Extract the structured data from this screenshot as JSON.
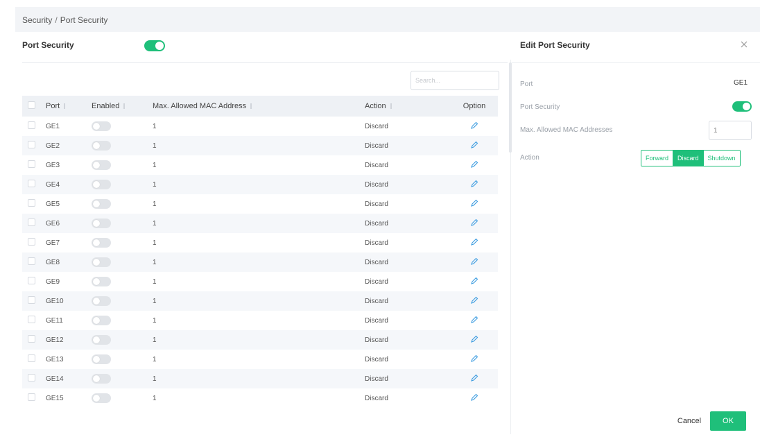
{
  "breadcrumb": {
    "parent": "Security",
    "separator": "/",
    "current": "Port Security"
  },
  "port_security": {
    "title": "Port Security",
    "enabled": true
  },
  "search": {
    "placeholder": "Search..."
  },
  "table": {
    "columns": {
      "port": "Port",
      "enabled": "Enabled",
      "max_mac": "Max. Allowed MAC Address",
      "action": "Action",
      "option": "Option"
    },
    "rows": [
      {
        "port": "GE1",
        "enabled": false,
        "max_mac": "1",
        "action": "Discard"
      },
      {
        "port": "GE2",
        "enabled": false,
        "max_mac": "1",
        "action": "Discard"
      },
      {
        "port": "GE3",
        "enabled": false,
        "max_mac": "1",
        "action": "Discard"
      },
      {
        "port": "GE4",
        "enabled": false,
        "max_mac": "1",
        "action": "Discard"
      },
      {
        "port": "GE5",
        "enabled": false,
        "max_mac": "1",
        "action": "Discard"
      },
      {
        "port": "GE6",
        "enabled": false,
        "max_mac": "1",
        "action": "Discard"
      },
      {
        "port": "GE7",
        "enabled": false,
        "max_mac": "1",
        "action": "Discard"
      },
      {
        "port": "GE8",
        "enabled": false,
        "max_mac": "1",
        "action": "Discard"
      },
      {
        "port": "GE9",
        "enabled": false,
        "max_mac": "1",
        "action": "Discard"
      },
      {
        "port": "GE10",
        "enabled": false,
        "max_mac": "1",
        "action": "Discard"
      },
      {
        "port": "GE11",
        "enabled": false,
        "max_mac": "1",
        "action": "Discard"
      },
      {
        "port": "GE12",
        "enabled": false,
        "max_mac": "1",
        "action": "Discard"
      },
      {
        "port": "GE13",
        "enabled": false,
        "max_mac": "1",
        "action": "Discard"
      },
      {
        "port": "GE14",
        "enabled": false,
        "max_mac": "1",
        "action": "Discard"
      },
      {
        "port": "GE15",
        "enabled": false,
        "max_mac": "1",
        "action": "Discard"
      }
    ]
  },
  "edit_panel": {
    "title": "Edit Port Security",
    "close_icon": "close-icon",
    "port_label": "Port",
    "port_value": "GE1",
    "port_security_label": "Port Security",
    "port_security_enabled": true,
    "max_label": "Max. Allowed MAC Addresses",
    "max_value": "1",
    "action_label": "Action",
    "actions": [
      "Forward",
      "Discard",
      "Shutdown"
    ],
    "selected_action": "Discard"
  },
  "footer": {
    "cancel_label": "Cancel",
    "ok_label": "OK"
  },
  "colors": {
    "accent": "#1fbf7a",
    "edit_icon": "#3a9be0",
    "header_bg": "#eef1f5"
  }
}
